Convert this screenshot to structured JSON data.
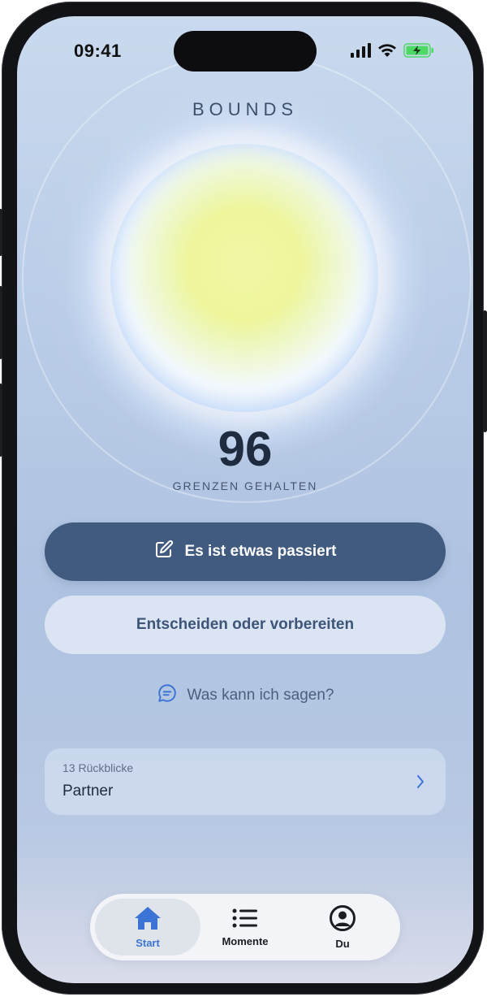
{
  "status_bar": {
    "time": "09:41",
    "icons": [
      "signal-icon",
      "wifi-icon",
      "battery-charging-icon"
    ],
    "battery_color": "#4cd964"
  },
  "app": {
    "brand": "BOUNDS"
  },
  "orb": {
    "count": "96",
    "label": "GRENZEN GEHALTEN"
  },
  "actions": {
    "primary_label": "Es ist etwas passiert",
    "primary_icon": "edit-icon",
    "secondary_label": "Entscheiden oder vorbereiten",
    "link_label": "Was kann ich sagen?",
    "link_icon": "chat-bubble-icon"
  },
  "review_card": {
    "subtitle": "13 Rückblicke",
    "title": "Partner",
    "icon": "chevron-right-icon"
  },
  "tabbar": {
    "items": [
      {
        "label": "Start",
        "icon": "home-icon",
        "active": true
      },
      {
        "label": "Momente",
        "icon": "list-icon",
        "active": false
      },
      {
        "label": "Du",
        "icon": "profile-icon",
        "active": false
      }
    ]
  },
  "colors": {
    "primary_button": "#415b80",
    "accent_active": "#3b74d4",
    "text_dark": "#1f2c40"
  }
}
